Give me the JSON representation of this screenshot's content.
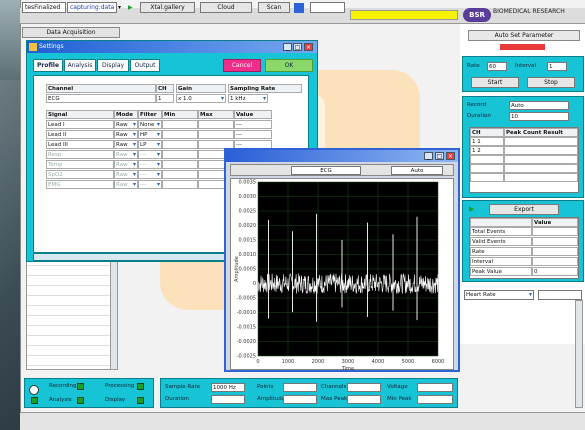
{
  "toolbar": {
    "account_field": "tesFinalized",
    "product_field": "capturing:data",
    "mode_button": "Xtal.gallery",
    "select_button": "Cloud",
    "scan_button": "Scan",
    "logo_text": "BSR",
    "brand_text": "BIOMEDICAL RESEARCH"
  },
  "subtab": {
    "label": "Data Acquisition"
  },
  "dialog": {
    "title": "Settings",
    "tabs": [
      "Profile",
      "Analysis",
      "Display",
      "Output"
    ],
    "cancel_label": "Cancel",
    "ok_label": "OK",
    "top_headers": [
      "Channel",
      "CH",
      "Gain",
      "Sampling Rate"
    ],
    "top_values": [
      "ECG",
      "1",
      "x 1.0",
      "1 kHz"
    ],
    "col_headers": [
      "Signal",
      "Mode",
      "Filter",
      "Min",
      "Max",
      "Value"
    ],
    "rows": [
      {
        "signal": "Lead I",
        "mode": "Raw",
        "filter": "None",
        "value": "---"
      },
      {
        "signal": "Lead II",
        "mode": "Raw",
        "filter": "HP",
        "value": "---"
      },
      {
        "signal": "Lead III",
        "mode": "Raw",
        "filter": "LP",
        "value": "---"
      },
      {
        "signal": "Resp",
        "mode": "Raw",
        "filter": "---",
        "value": ""
      },
      {
        "signal": "Temp",
        "mode": "Raw",
        "filter": "---",
        "value": ""
      },
      {
        "signal": "SpO2",
        "mode": "Raw",
        "filter": "---",
        "value": ""
      },
      {
        "signal": "EMG",
        "mode": "Raw",
        "filter": "---",
        "value": ""
      }
    ]
  },
  "plot": {
    "title": "",
    "dropdown_left": "ECG",
    "dropdown_right": "Auto",
    "ylabel": "Amplitude",
    "xlabel": "Time"
  },
  "chart_data": {
    "type": "line",
    "title": "",
    "xlabel": "Time",
    "ylabel": "Amplitude",
    "yticks": [
      "0.0035",
      "0.0030",
      "0.0025",
      "0.0020",
      "0.0015",
      "0.0010",
      "0.0005",
      "0",
      "-0.0005",
      "-0.0010",
      "-0.0015",
      "-0.0020",
      "-0.0025"
    ],
    "xticks": [
      "0",
      "1000",
      "2000",
      "3000",
      "4000",
      "5000",
      "6000"
    ],
    "xlim": [
      0,
      6000
    ],
    "ylim": [
      -0.0025,
      0.0035
    ],
    "spikes_x": [
      350,
      1150,
      1950,
      2800,
      3650,
      4500,
      5300
    ],
    "spike_heights": [
      0.0022,
      0.0018,
      0.0024,
      0.0015,
      0.0021,
      0.0017,
      0.0023
    ],
    "baseline": 0.0,
    "noise_band": 0.00035,
    "trace_color": "#ffffff",
    "background": "#000000",
    "grid": true
  },
  "right_panel": {
    "top_button": "Auto Set Parameter",
    "box1": {
      "lbl1": "Rate",
      "val1": "60",
      "lbl2": "Interval",
      "val2": "1"
    },
    "box1_buttons": [
      "Start",
      "Stop"
    ],
    "box2": {
      "lbl1": "Record",
      "val1": "Auto",
      "lbl2": "Duration",
      "val2": "10"
    },
    "table_headers": [
      "CH",
      "Peak Count Result"
    ],
    "table_rows": [
      "1 1",
      "1 2",
      "",
      "",
      ""
    ],
    "box3_button": "Export",
    "box3_headers": [
      "",
      "Value"
    ],
    "box3_rows": [
      [
        "Total Events",
        ""
      ],
      [
        "Valid Events",
        ""
      ],
      [
        "Rate",
        ""
      ],
      [
        "Interval",
        ""
      ],
      [
        "Peak Value",
        "0"
      ]
    ],
    "bottom_field": "Heart Rate"
  },
  "status": {
    "left_items": [
      "Recording",
      "Processing",
      "Analysis",
      "Display"
    ],
    "mid_labels": [
      "Sample Rate",
      "Points",
      "Channels",
      "Voltage",
      "Duration",
      "Amplitude",
      "Max Peak",
      "Min Peak"
    ],
    "mid_values": [
      "1000 Hz",
      "",
      "",
      "",
      "",
      "",
      "",
      ""
    ]
  }
}
